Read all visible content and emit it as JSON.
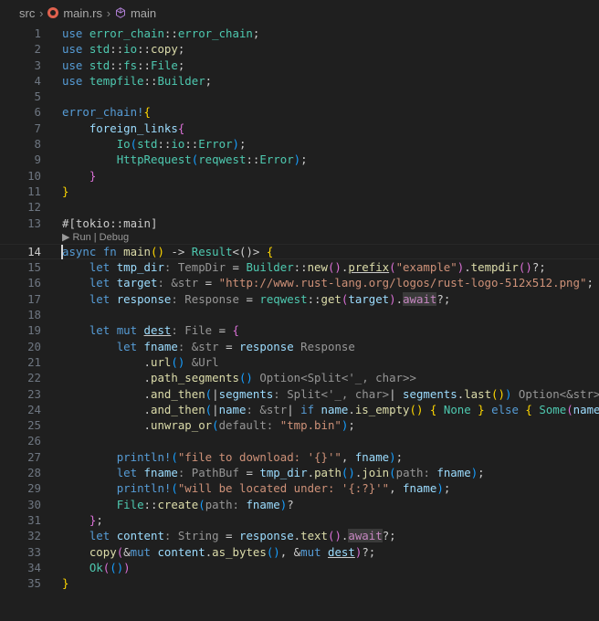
{
  "breadcrumb": {
    "folder": "src",
    "file": "main.rs",
    "symbol": "main"
  },
  "codelens": "▶ Run | Debug",
  "current_line": 14,
  "lines": [
    {
      "n": "1",
      "t": [
        [
          "kw",
          "use "
        ],
        [
          "ty",
          "error_chain"
        ],
        [
          "pu",
          "::"
        ],
        [
          "ty",
          "error_chain"
        ],
        [
          "pu",
          ";"
        ]
      ]
    },
    {
      "n": "2",
      "t": [
        [
          "kw",
          "use "
        ],
        [
          "ty",
          "std"
        ],
        [
          "pu",
          "::"
        ],
        [
          "ty",
          "io"
        ],
        [
          "pu",
          "::"
        ],
        [
          "fn",
          "copy"
        ],
        [
          "pu",
          ";"
        ]
      ]
    },
    {
      "n": "3",
      "t": [
        [
          "kw",
          "use "
        ],
        [
          "ty",
          "std"
        ],
        [
          "pu",
          "::"
        ],
        [
          "ty",
          "fs"
        ],
        [
          "pu",
          "::"
        ],
        [
          "ty",
          "File"
        ],
        [
          "pu",
          ";"
        ]
      ]
    },
    {
      "n": "4",
      "t": [
        [
          "kw",
          "use "
        ],
        [
          "ty",
          "tempfile"
        ],
        [
          "pu",
          "::"
        ],
        [
          "ty",
          "Builder"
        ],
        [
          "pu",
          ";"
        ]
      ]
    },
    {
      "n": "5",
      "t": []
    },
    {
      "n": "6",
      "t": [
        [
          "mc",
          "error_chain!"
        ],
        [
          "b1",
          "{"
        ]
      ]
    },
    {
      "n": "7",
      "t": [
        [
          "pu",
          "    "
        ],
        [
          "vr",
          "foreign_links"
        ],
        [
          "b2",
          "{"
        ]
      ]
    },
    {
      "n": "8",
      "t": [
        [
          "pu",
          "        "
        ],
        [
          "ty",
          "Io"
        ],
        [
          "b3",
          "("
        ],
        [
          "ty",
          "std"
        ],
        [
          "pu",
          "::"
        ],
        [
          "ty",
          "io"
        ],
        [
          "pu",
          "::"
        ],
        [
          "ty",
          "Error"
        ],
        [
          "b3",
          ")"
        ],
        [
          "pu",
          ";"
        ]
      ]
    },
    {
      "n": "9",
      "t": [
        [
          "pu",
          "        "
        ],
        [
          "ty",
          "HttpRequest"
        ],
        [
          "b3",
          "("
        ],
        [
          "ty",
          "reqwest"
        ],
        [
          "pu",
          "::"
        ],
        [
          "ty",
          "Error"
        ],
        [
          "b3",
          ")"
        ],
        [
          "pu",
          ";"
        ]
      ]
    },
    {
      "n": "10",
      "t": [
        [
          "pu",
          "    "
        ],
        [
          "b2",
          "}"
        ]
      ]
    },
    {
      "n": "11",
      "t": [
        [
          "b1",
          "}"
        ]
      ]
    },
    {
      "n": "12",
      "t": []
    },
    {
      "n": "13",
      "t": [
        [
          "pu",
          "#[tokio::main]"
        ]
      ]
    },
    {
      "n": "14",
      "t": [
        [
          "kw",
          "async "
        ],
        [
          "kw",
          "fn "
        ],
        [
          "fn",
          "main"
        ],
        [
          "b1",
          "()"
        ],
        [
          "pu",
          " -> "
        ],
        [
          "ty",
          "Result"
        ],
        [
          "pu",
          "<()> "
        ],
        [
          "b1",
          "{"
        ]
      ]
    },
    {
      "n": "15",
      "t": [
        [
          "pu",
          "    "
        ],
        [
          "kw",
          "let "
        ],
        [
          "vr",
          "tmp_dir"
        ],
        [
          "hint",
          ": TempDir"
        ],
        [
          "pu",
          " = "
        ],
        [
          "ty",
          "Builder"
        ],
        [
          "pu",
          "::"
        ],
        [
          "fn",
          "new"
        ],
        [
          "b2",
          "()"
        ],
        [
          "pu",
          "."
        ],
        [
          "fn ul",
          "prefix"
        ],
        [
          "b2",
          "("
        ],
        [
          "st",
          "\"example\""
        ],
        [
          "b2",
          ")"
        ],
        [
          "pu",
          "."
        ],
        [
          "fn",
          "tempdir"
        ],
        [
          "b2",
          "()"
        ],
        [
          "pu",
          "?;"
        ]
      ]
    },
    {
      "n": "16",
      "t": [
        [
          "pu",
          "    "
        ],
        [
          "kw",
          "let "
        ],
        [
          "vr",
          "target"
        ],
        [
          "hint",
          ": &str"
        ],
        [
          "pu",
          " = "
        ],
        [
          "st",
          "\"http://www.rust-lang.org/logos/rust-logo-512x512.png\""
        ],
        [
          "pu",
          ";"
        ]
      ]
    },
    {
      "n": "17",
      "t": [
        [
          "pu",
          "    "
        ],
        [
          "kw",
          "let "
        ],
        [
          "vr",
          "response"
        ],
        [
          "hint",
          ": Response"
        ],
        [
          "pu",
          " = "
        ],
        [
          "ty",
          "reqwest"
        ],
        [
          "pu",
          "::"
        ],
        [
          "fn",
          "get"
        ],
        [
          "b2",
          "("
        ],
        [
          "vr",
          "target"
        ],
        [
          "b2",
          ")"
        ],
        [
          "pu",
          "."
        ],
        [
          "aw",
          "await"
        ],
        [
          "pu",
          "?;"
        ]
      ]
    },
    {
      "n": "18",
      "t": []
    },
    {
      "n": "19",
      "t": [
        [
          "pu",
          "    "
        ],
        [
          "kw",
          "let "
        ],
        [
          "kw",
          "mut "
        ],
        [
          "vr ul",
          "dest"
        ],
        [
          "hint",
          ": File"
        ],
        [
          "pu",
          " = "
        ],
        [
          "b2",
          "{"
        ]
      ]
    },
    {
      "n": "20",
      "t": [
        [
          "pu",
          "        "
        ],
        [
          "kw",
          "let "
        ],
        [
          "vr",
          "fname"
        ],
        [
          "hint",
          ": &str"
        ],
        [
          "pu",
          " = "
        ],
        [
          "vr",
          "response"
        ],
        [
          "hint",
          " Response"
        ]
      ]
    },
    {
      "n": "21",
      "t": [
        [
          "pu",
          "            ."
        ],
        [
          "fn",
          "url"
        ],
        [
          "b3",
          "()"
        ],
        [
          "hint",
          " &Url"
        ]
      ]
    },
    {
      "n": "22",
      "t": [
        [
          "pu",
          "            ."
        ],
        [
          "fn",
          "path_segments"
        ],
        [
          "b3",
          "()"
        ],
        [
          "hint",
          " Option<Split<'_, char>>"
        ]
      ]
    },
    {
      "n": "23",
      "t": [
        [
          "pu",
          "            ."
        ],
        [
          "fn",
          "and_then"
        ],
        [
          "b3",
          "("
        ],
        [
          "pu",
          "|"
        ],
        [
          "vr",
          "segments"
        ],
        [
          "hint",
          ": Split<'_, char>"
        ],
        [
          "pu",
          "| "
        ],
        [
          "vr",
          "segments"
        ],
        [
          "pu",
          "."
        ],
        [
          "fn",
          "last"
        ],
        [
          "b1",
          "()"
        ],
        [
          "b3",
          ")"
        ],
        [
          "hint",
          " Option<&str>"
        ]
      ]
    },
    {
      "n": "24",
      "t": [
        [
          "pu",
          "            ."
        ],
        [
          "fn",
          "and_then"
        ],
        [
          "b3",
          "("
        ],
        [
          "pu",
          "|"
        ],
        [
          "vr",
          "name"
        ],
        [
          "hint",
          ": &str"
        ],
        [
          "pu",
          "| "
        ],
        [
          "kw",
          "if "
        ],
        [
          "vr",
          "name"
        ],
        [
          "pu",
          "."
        ],
        [
          "fn",
          "is_empty"
        ],
        [
          "b1",
          "()"
        ],
        [
          "pu",
          " "
        ],
        [
          "b1",
          "{"
        ],
        [
          "pu",
          " "
        ],
        [
          "ty",
          "None"
        ],
        [
          "pu",
          " "
        ],
        [
          "b1",
          "}"
        ],
        [
          "pu",
          " "
        ],
        [
          "kw",
          "else "
        ],
        [
          "b1",
          "{"
        ],
        [
          "pu",
          " "
        ],
        [
          "ty",
          "Some"
        ],
        [
          "b2",
          "("
        ],
        [
          "vr",
          "name"
        ],
        [
          "b2",
          ")"
        ],
        [
          "pu",
          " "
        ],
        [
          "b1",
          "}"
        ],
        [
          "b3",
          ")"
        ]
      ]
    },
    {
      "n": "25",
      "t": [
        [
          "pu",
          "            ."
        ],
        [
          "fn",
          "unwrap_or"
        ],
        [
          "b3",
          "("
        ],
        [
          "hint",
          "default: "
        ],
        [
          "st",
          "\"tmp.bin\""
        ],
        [
          "b3",
          ")"
        ],
        [
          "pu",
          ";"
        ]
      ]
    },
    {
      "n": "26",
      "t": []
    },
    {
      "n": "27",
      "t": [
        [
          "pu",
          "        "
        ],
        [
          "mc",
          "println!"
        ],
        [
          "b3",
          "("
        ],
        [
          "st",
          "\"file to download: '{}'\""
        ],
        [
          "pu",
          ", "
        ],
        [
          "vr",
          "fname"
        ],
        [
          "b3",
          ")"
        ],
        [
          "pu",
          ";"
        ]
      ]
    },
    {
      "n": "28",
      "t": [
        [
          "pu",
          "        "
        ],
        [
          "kw",
          "let "
        ],
        [
          "vr",
          "fname"
        ],
        [
          "hint",
          ": PathBuf"
        ],
        [
          "pu",
          " = "
        ],
        [
          "vr",
          "tmp_dir"
        ],
        [
          "pu",
          "."
        ],
        [
          "fn",
          "path"
        ],
        [
          "b3",
          "()"
        ],
        [
          "pu",
          "."
        ],
        [
          "fn",
          "join"
        ],
        [
          "b3",
          "("
        ],
        [
          "hint",
          "path: "
        ],
        [
          "vr",
          "fname"
        ],
        [
          "b3",
          ")"
        ],
        [
          "pu",
          ";"
        ]
      ]
    },
    {
      "n": "29",
      "t": [
        [
          "pu",
          "        "
        ],
        [
          "mc",
          "println!"
        ],
        [
          "b3",
          "("
        ],
        [
          "st",
          "\"will be located under: '{:?}'\""
        ],
        [
          "pu",
          ", "
        ],
        [
          "vr",
          "fname"
        ],
        [
          "b3",
          ")"
        ],
        [
          "pu",
          ";"
        ]
      ]
    },
    {
      "n": "30",
      "t": [
        [
          "pu",
          "        "
        ],
        [
          "ty",
          "File"
        ],
        [
          "pu",
          "::"
        ],
        [
          "fn",
          "create"
        ],
        [
          "b3",
          "("
        ],
        [
          "hint",
          "path: "
        ],
        [
          "vr",
          "fname"
        ],
        [
          "b3",
          ")"
        ],
        [
          "pu",
          "?"
        ]
      ]
    },
    {
      "n": "31",
      "t": [
        [
          "pu",
          "    "
        ],
        [
          "b2",
          "}"
        ],
        [
          "pu",
          ";"
        ]
      ]
    },
    {
      "n": "32",
      "t": [
        [
          "pu",
          "    "
        ],
        [
          "kw",
          "let "
        ],
        [
          "vr",
          "content"
        ],
        [
          "hint",
          ": String"
        ],
        [
          "pu",
          " = "
        ],
        [
          "vr",
          "response"
        ],
        [
          "pu",
          "."
        ],
        [
          "fn",
          "text"
        ],
        [
          "b2",
          "()"
        ],
        [
          "pu",
          "."
        ],
        [
          "aw",
          "await"
        ],
        [
          "pu",
          "?;"
        ]
      ]
    },
    {
      "n": "33",
      "t": [
        [
          "pu",
          "    "
        ],
        [
          "fn",
          "copy"
        ],
        [
          "b2",
          "("
        ],
        [
          "pu",
          "&"
        ],
        [
          "kw",
          "mut "
        ],
        [
          "vr",
          "content"
        ],
        [
          "pu",
          "."
        ],
        [
          "fn",
          "as_bytes"
        ],
        [
          "b3",
          "()"
        ],
        [
          "pu",
          ", &"
        ],
        [
          "kw",
          "mut "
        ],
        [
          "vr ul",
          "dest"
        ],
        [
          "b2",
          ")"
        ],
        [
          "pu",
          "?;"
        ]
      ]
    },
    {
      "n": "34",
      "t": [
        [
          "pu",
          "    "
        ],
        [
          "ty",
          "Ok"
        ],
        [
          "b2",
          "("
        ],
        [
          "b3",
          "()"
        ],
        [
          "b2",
          ")"
        ]
      ]
    },
    {
      "n": "35",
      "t": [
        [
          "b1",
          "}"
        ]
      ]
    }
  ]
}
